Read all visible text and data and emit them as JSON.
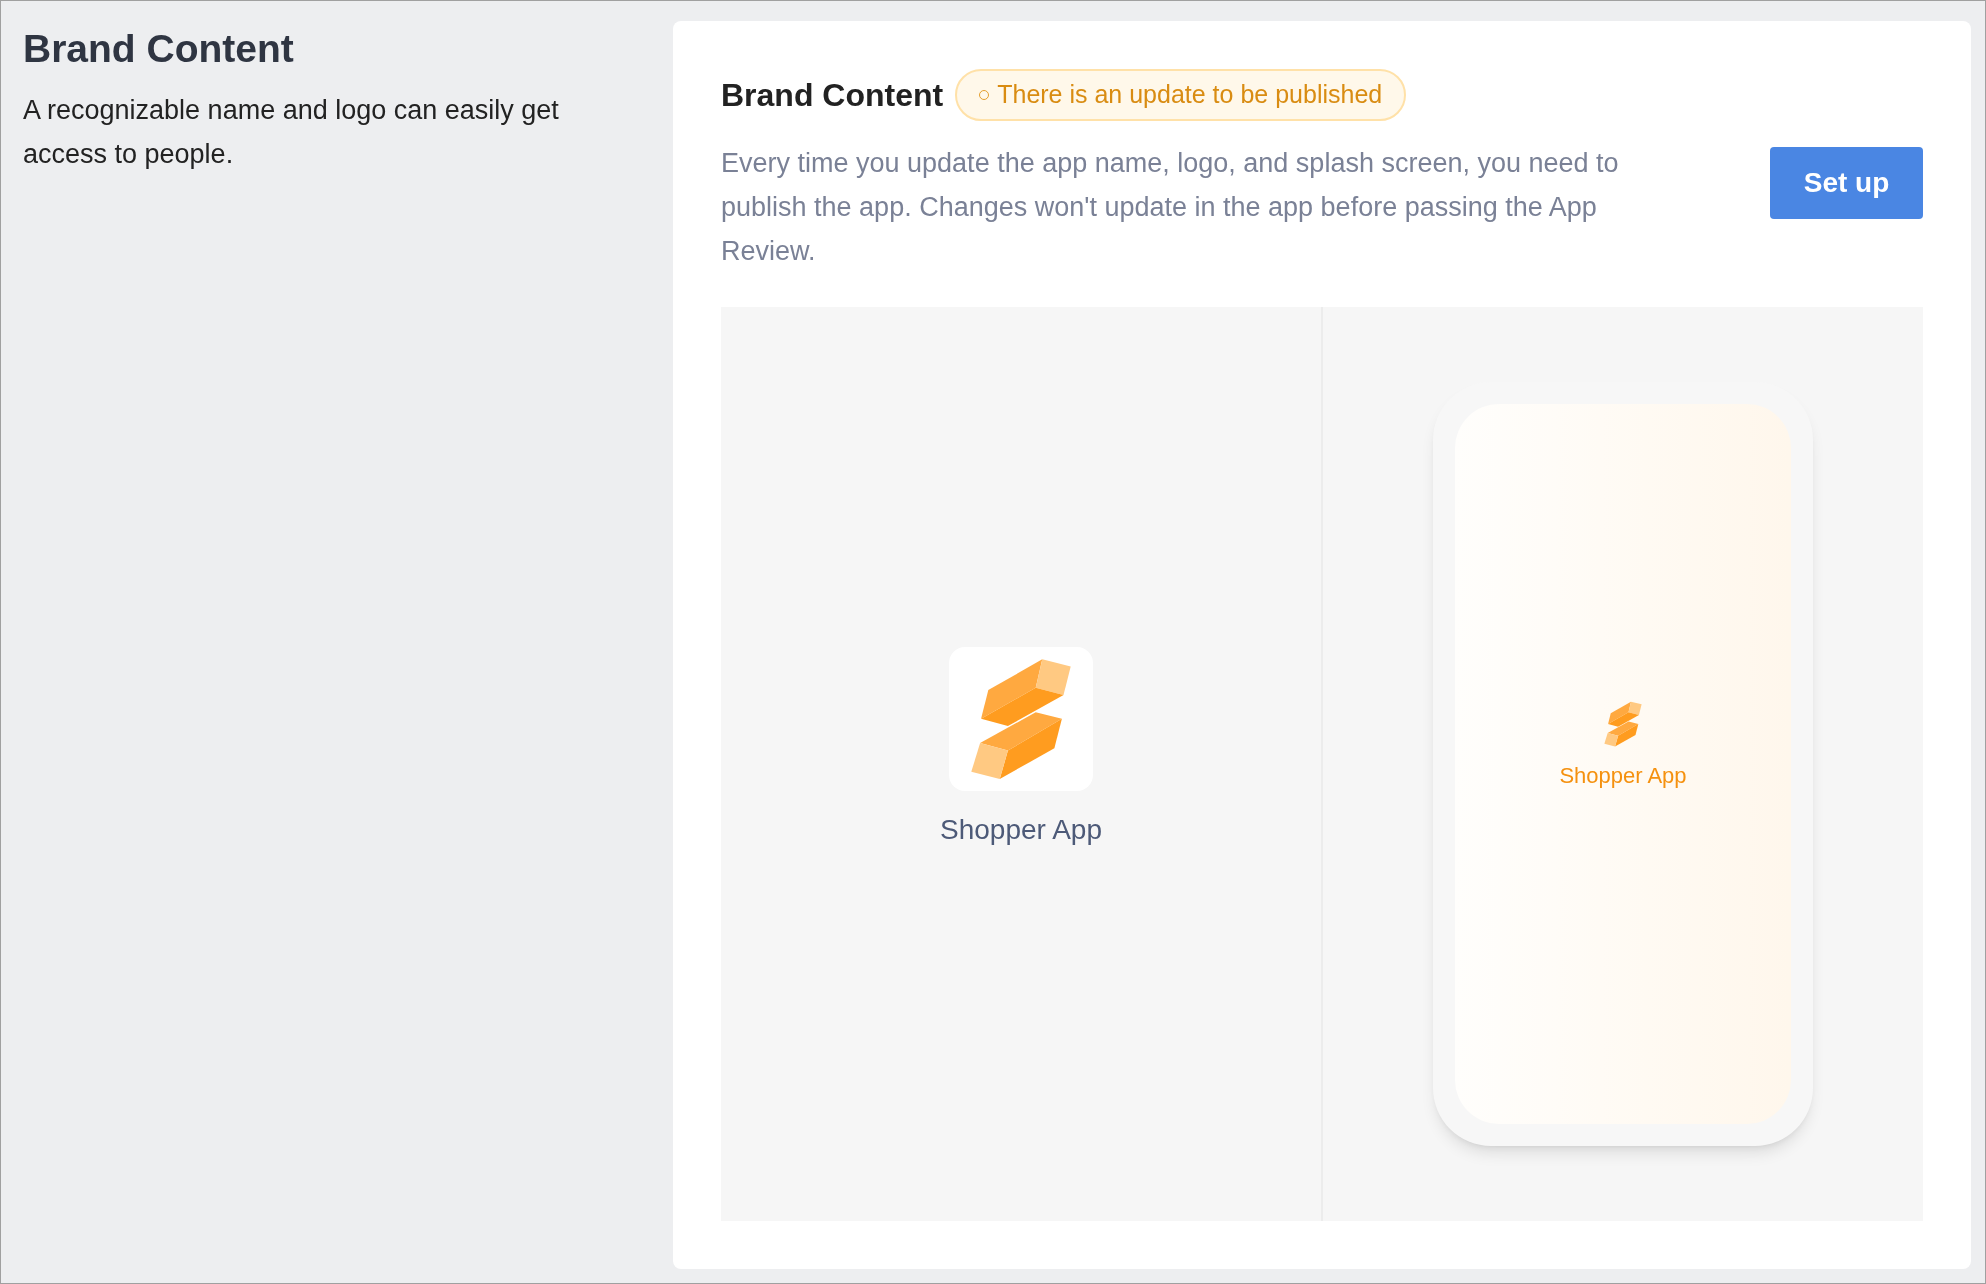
{
  "sidebar": {
    "title": "Brand Content",
    "description": "A recognizable name and logo can easily get access to people."
  },
  "card": {
    "title": "Brand Content",
    "badge": "There is an update to be published",
    "description": "Every time you update the app name, logo, and splash screen, you need to publish the app. Changes won't update in the app before passing the App Review.",
    "button": "Set up"
  },
  "preview": {
    "icon_label": "Shopper App",
    "splash_label": "Shopper App"
  }
}
